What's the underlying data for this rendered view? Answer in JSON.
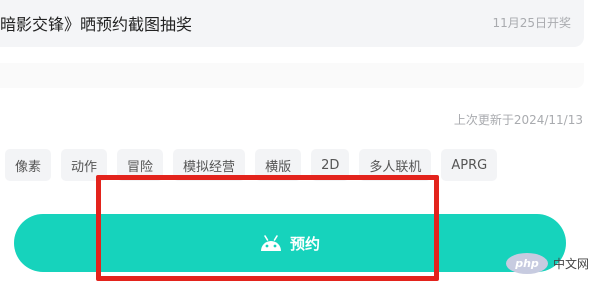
{
  "event": {
    "title": "暗影交锋》晒预约截图抽奖",
    "date": "11月25日开奖"
  },
  "meta": {
    "updated": "上次更新于2024/11/13"
  },
  "tags": [
    "像素",
    "动作",
    "冒险",
    "模拟经营",
    "横版",
    "2D",
    "多人联机",
    "APRG"
  ],
  "reserve_button": {
    "label": "预约",
    "icon": "android-icon",
    "color": "#16d3bc"
  },
  "highlight": {
    "color": "#e3231c"
  },
  "watermark": {
    "logo": "php",
    "text": "中文网"
  }
}
